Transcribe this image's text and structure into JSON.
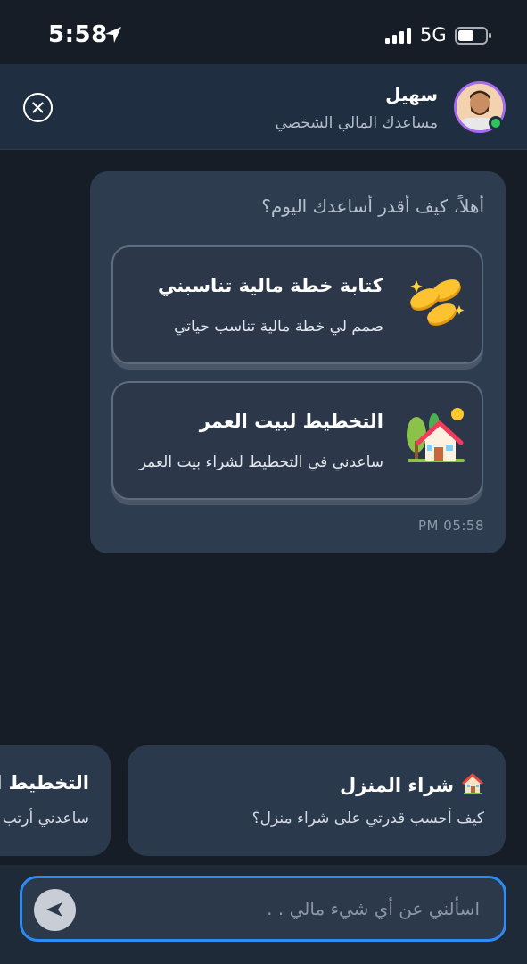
{
  "status_bar": {
    "time": "5:58",
    "network": "5G",
    "icons": [
      "location-arrow-icon",
      "signal-bars-icon",
      "battery-icon"
    ]
  },
  "header": {
    "assistant_name": "سهيل",
    "assistant_subtitle": "مساعدك المالي الشخصي",
    "status": "online",
    "icons": [
      "close-icon",
      "avatar"
    ]
  },
  "message": {
    "greeting": "أهلاً، كيف أقدر أساعدك اليوم؟",
    "options": [
      {
        "title": "كتابة خطة مالية تناسبني",
        "description": "صمم لي خطة مالية تناسب حياتي",
        "icon": "coins-icon"
      },
      {
        "title": "التخطيط لبيت العمر",
        "description": "ساعدني في التخطيط لشراء بيت العمر",
        "icon": "house-icon"
      }
    ],
    "timestamp": "PM 05:58"
  },
  "suggestions": [
    {
      "title": "شراء المنزل",
      "description": "كيف أحسب قدرتي على شراء منزل؟",
      "icon": "house-emoji-icon"
    },
    {
      "title": "التخطيط ال",
      "description": "ساعدني أرتب"
    }
  ],
  "composer": {
    "placeholder": "اسألني عن أي شيء مالي . .",
    "send_icon": "send-icon"
  },
  "colors": {
    "background": "#161d26",
    "header": "#1f2e40",
    "bubble": "#2e3c50",
    "accent": "#2c8cf4",
    "online": "#2ec25c",
    "avatar_ring": "#a66cf0"
  }
}
